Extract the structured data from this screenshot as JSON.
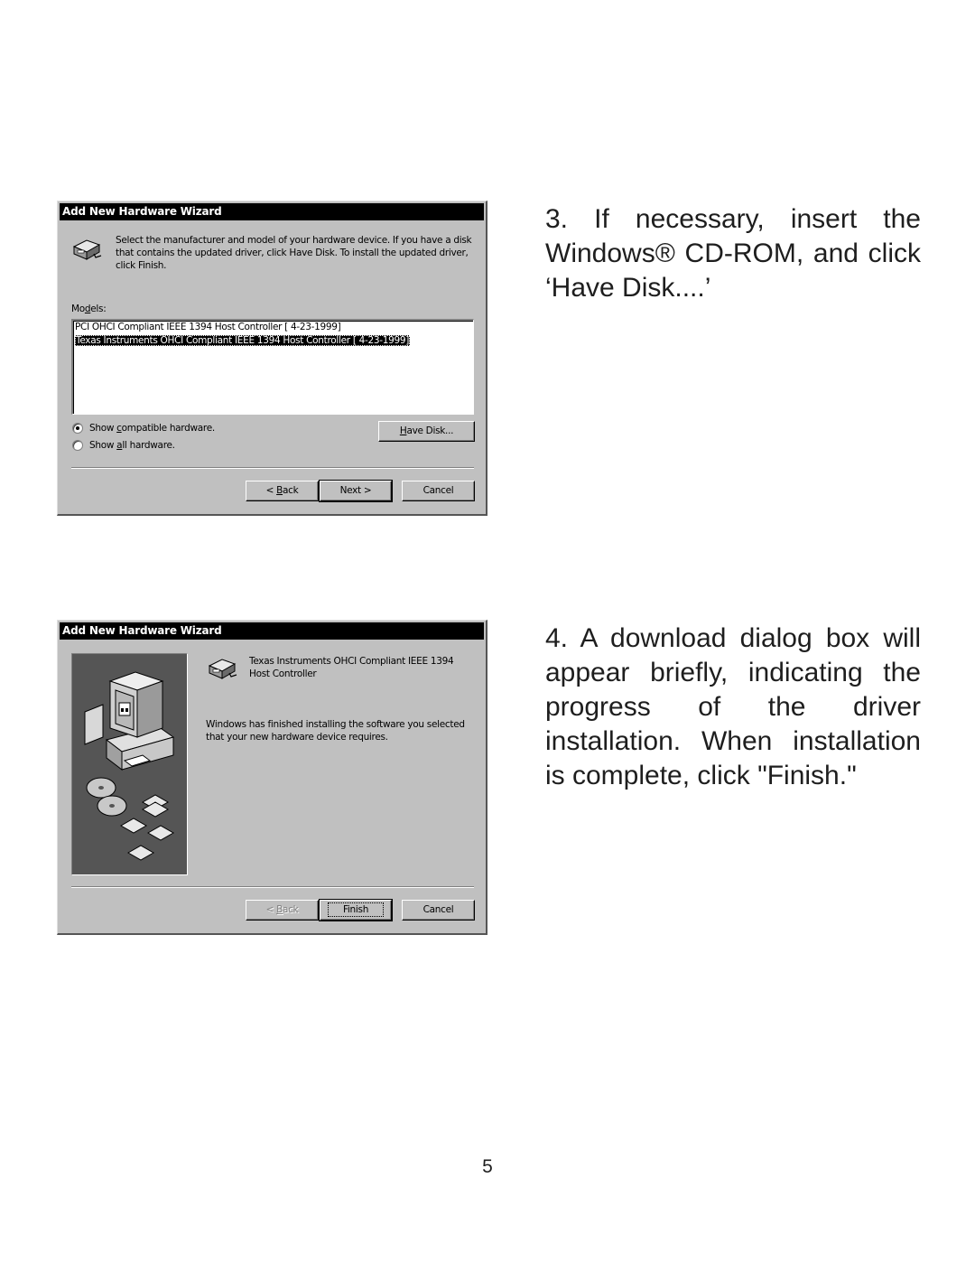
{
  "dialog1": {
    "title": "Add New Hardware Wizard",
    "icon": "hardware-device-icon",
    "description": "Select the manufacturer and model of your hardware device. If you have a disk that contains the updated driver, click Have Disk. To install the updated driver, click Finish.",
    "models_label": {
      "pre": "Mo",
      "accel": "d",
      "post": "els:"
    },
    "models": [
      {
        "label": "PCI OHCI Compliant IEEE 1394 Host Controller [ 4-23-1999]",
        "selected": false
      },
      {
        "label": "Texas Instruments OHCI Compliant IEEE 1394 Host Controller [ 4-23-1999]",
        "selected": true
      }
    ],
    "radios": [
      {
        "pre": "Show ",
        "accel": "c",
        "post": "ompatible hardware.",
        "checked": true
      },
      {
        "pre": "Show ",
        "accel": "a",
        "post": "ll hardware.",
        "checked": false
      }
    ],
    "have_disk": {
      "accel": "H",
      "post": "ave Disk..."
    },
    "back": {
      "pre": "< ",
      "accel": "B",
      "post": "ack"
    },
    "next": "Next >",
    "cancel": "Cancel"
  },
  "dialog2": {
    "title": "Add New Hardware Wizard",
    "icon": "hardware-device-icon",
    "illustration": "computer-with-disks-illustration",
    "device_name": "Texas Instruments OHCI Compliant IEEE 1394 Host Controller",
    "message": "Windows has finished installing the software you selected that your new hardware device requires.",
    "back": {
      "pre": "< ",
      "accel": "B",
      "post": "ack",
      "disabled": true
    },
    "finish": "Finish",
    "cancel": "Cancel"
  },
  "instructions": {
    "step3": "3. If necessary, insert the Windows® CD-ROM, and click ‘Have Disk....’",
    "step4": "4. A download dialog box will appear briefly, indicating the progress of the driver installation. When installation is complete, click \"Finish.\""
  },
  "page_number": "5"
}
